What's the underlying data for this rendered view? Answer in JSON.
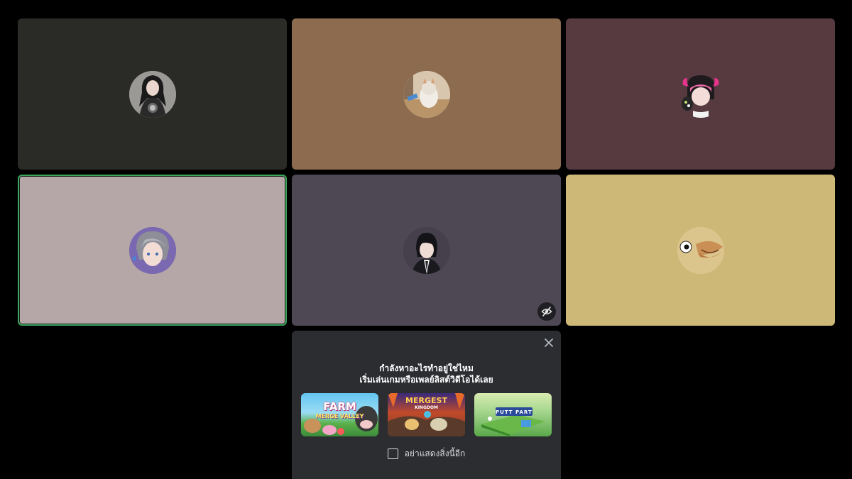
{
  "participants": [
    {
      "avatar": "user-avatar",
      "tile_color": "#2a2b26",
      "speaking": false
    },
    {
      "avatar": "cat-avatar",
      "tile_color": "#8c6b4e",
      "speaking": false
    },
    {
      "avatar": "pink-hair-avatar",
      "tile_color": "#563a40",
      "speaking": false
    },
    {
      "avatar": "silver-hair-avatar",
      "tile_color": "#b5a6a7",
      "speaking": true
    },
    {
      "avatar": "dark-hair-avatar",
      "tile_color": "#4e4855",
      "speaking": false,
      "stream_off_icon": "eye-slash-icon"
    },
    {
      "avatar": "duck-avatar",
      "tile_color": "#ceb878",
      "speaking": false
    }
  ],
  "activity_prompt": {
    "line1": "กำลังหาอะไรทำอยู่ใช่ไหม",
    "line2": "เริ่มเล่นเกมหรือเพลย์ลิสต์วิดีโอได้เลย",
    "close_icon": "close-icon",
    "activities": [
      {
        "title_top": "FARM",
        "title_bottom": "MERGE VALLEY",
        "colors": [
          "#64c5f0",
          "#f0a0c0",
          "#3c9a3c"
        ]
      },
      {
        "title_top": "MERGEST",
        "title_bottom": "KINGDOM",
        "colors": [
          "#c04a2a",
          "#6a3b8a",
          "#e0a060"
        ]
      },
      {
        "title_top": "PUTT PARTY",
        "title_bottom": "",
        "colors": [
          "#cfe8a8",
          "#5aa0d8",
          "#4a9a4a"
        ]
      }
    ],
    "checkbox_label": "อย่าแสดงสิ่งนี้อีก"
  }
}
